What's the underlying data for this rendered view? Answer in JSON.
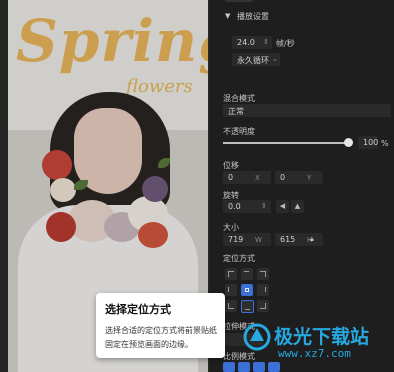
{
  "preview": {
    "title": "Spring",
    "subtitle": "flowers"
  },
  "panel": {
    "playback_settings": "播放设置",
    "fps_value": "24.0",
    "fps_unit": "帧/秒",
    "loop_option": "永久循环",
    "blend_mode_label": "混合模式",
    "blend_mode_value": "正常",
    "opacity_label": "不透明度",
    "opacity_value": "100",
    "opacity_unit": "%",
    "opacity_level": 1.0,
    "position_label": "位移",
    "pos_x_value": "0",
    "pos_x_unit": "X",
    "pos_y_value": "0",
    "pos_y_unit": "Y",
    "rotate_label": "旋转",
    "rotate_value": "0.0",
    "size_label": "大小",
    "width_value": "719",
    "width_unit": "W",
    "height_value": "615",
    "height_unit": "H",
    "anchor_label": "定位方式",
    "anchor_selected": "bottom-center",
    "stretch_label": "拉伸模式",
    "ratio_label": "比例模式"
  },
  "tooltip": {
    "title": "选择定位方式",
    "description": "选择合适的定位方式将前景贴纸固定在预览画面的边缘。"
  },
  "watermark": {
    "name": "极光下载站",
    "url": "www.xz7.com"
  },
  "colors": {
    "accent": "#3d6fd8",
    "title_yellow": "#e8b65a",
    "watermark_blue": "#27a8e0"
  }
}
